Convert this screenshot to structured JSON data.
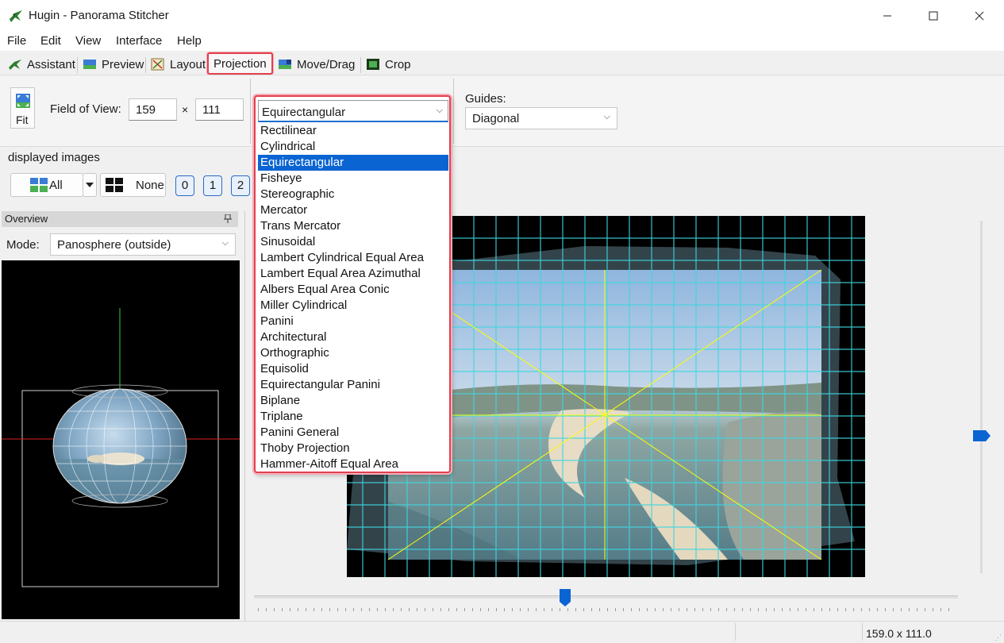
{
  "window": {
    "title": "Hugin - Panorama Stitcher"
  },
  "menu": [
    "File",
    "Edit",
    "View",
    "Interface",
    "Help"
  ],
  "tabs": [
    {
      "label": "Assistant",
      "icon": "assistant-icon"
    },
    {
      "label": "Preview",
      "icon": "preview-icon"
    },
    {
      "label": "Layout",
      "icon": "layout-icon"
    },
    {
      "label": "Projection",
      "icon": "",
      "active": true
    },
    {
      "label": "Move/Drag",
      "icon": "move-drag-icon"
    },
    {
      "label": "Crop",
      "icon": "crop-icon"
    }
  ],
  "toolbar": {
    "fit_label": "Fit",
    "fov_label": "Field of View:",
    "fov_h": "159",
    "times": "×",
    "fov_v": "111",
    "projection_selected": "Equirectangular",
    "guides_label": "Guides:",
    "guides_value": "Diagonal"
  },
  "displayed": {
    "label": "displayed images",
    "all_label": "All",
    "none_label": "None",
    "image_buttons": [
      "0",
      "1",
      "2"
    ]
  },
  "overview": {
    "header": "Overview",
    "mode_label": "Mode:",
    "mode_value": "Panosphere (outside)"
  },
  "projection_options": [
    "Rectilinear",
    "Cylindrical",
    "Equirectangular",
    "Fisheye",
    "Stereographic",
    "Mercator",
    "Trans Mercator",
    "Sinusoidal",
    "Lambert Cylindrical Equal Area",
    "Lambert Equal Area Azimuthal",
    "Albers Equal Area Conic",
    "Miller Cylindrical",
    "Panini",
    "Architectural",
    "Orthographic",
    "Equisolid",
    "Equirectangular Panini",
    "Biplane",
    "Triplane",
    "Panini General",
    "Thoby Projection",
    "Hammer-Aitoff Equal Area"
  ],
  "selected_projection_index": 2,
  "status": {
    "size": "159.0 x 111.0"
  },
  "colors": {
    "accent": "#0a64d2",
    "highlight": "#e04050",
    "grid": "#3fd6e0",
    "guide": "#ffff00"
  }
}
